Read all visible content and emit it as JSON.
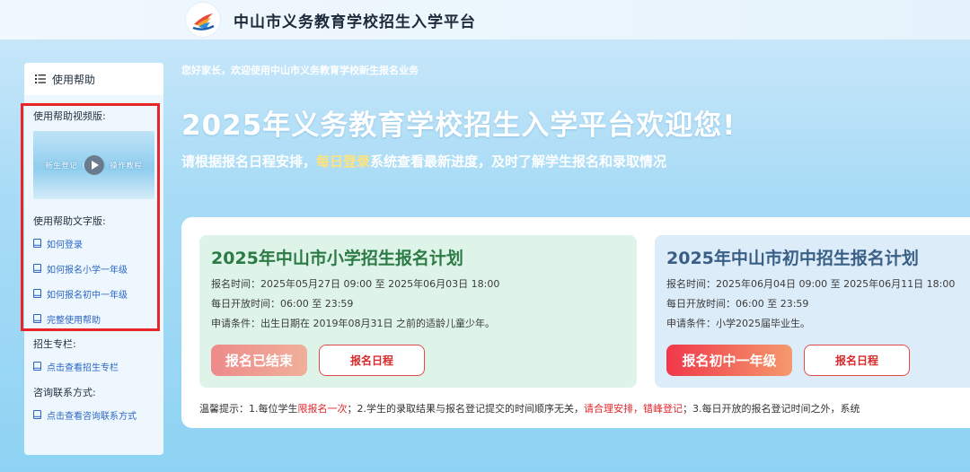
{
  "header": {
    "site_title": "中山市义务教育学校招生入学平台"
  },
  "sidebar": {
    "head_label": "使用帮助",
    "video_section_title": "使用帮助视频版:",
    "video_thumb_text": "新生登记（小学）操作教程",
    "text_section_title": "使用帮助文字版:",
    "help_links": [
      {
        "label": "如何登录"
      },
      {
        "label": "如何报名小学一年级"
      },
      {
        "label": "如何报名初中一年级"
      },
      {
        "label": "完整使用帮助"
      }
    ],
    "column_title": "招生专栏:",
    "column_link": "点击查看招生专栏",
    "contact_title": "咨询联系方式:",
    "contact_link": "点击查看咨询联系方式"
  },
  "hero": {
    "greeting": "您好家长，欢迎使用中山市义务教育学校新生报名业务",
    "title": "2025年义务教育学校招生入学平台欢迎您!",
    "subtitle_pre": "请根据报名日程安排，",
    "subtitle_highlight": "每日登录",
    "subtitle_post": "系统查看最新进度，及时了解学生报名和录取情况"
  },
  "cards": [
    {
      "title": "2025年中山市小学招生报名计划",
      "time": "报名时间：2025年05月27日 09:00 至 2025年06月03日 18:00",
      "open_hours": "每日开放时间：06:00 至 23:59",
      "condition": "申请条件：出生日期在 2019年08月31日 之前的适龄儿童少年。",
      "status_button": "报名已结束",
      "schedule_button": "报名日程"
    },
    {
      "title": "2025年中山市初中招生报名计划",
      "time": "报名时间：2025年06月04日 09:00 至 2025年06月11日 18:00",
      "open_hours": "每日开放时间：06:00 至 23:59",
      "condition": "申请条件：小学2025届毕业生。",
      "status_button": "报名初中一年级",
      "schedule_button": "报名日程"
    }
  ],
  "tips": {
    "p1": "温馨提示：1.每位学生",
    "r1": "限报名一次",
    "p2": "；2.学生的录取结果与报名登记提交的时间顺序无关，",
    "r2": "请合理安排，错峰登记",
    "p3": "；3.每日开放的报名登记时间之外，系统"
  },
  "colors": {
    "accent_red": "#e8262a",
    "link_blue": "#2b66c6",
    "primary_green": "#2c7a45"
  }
}
